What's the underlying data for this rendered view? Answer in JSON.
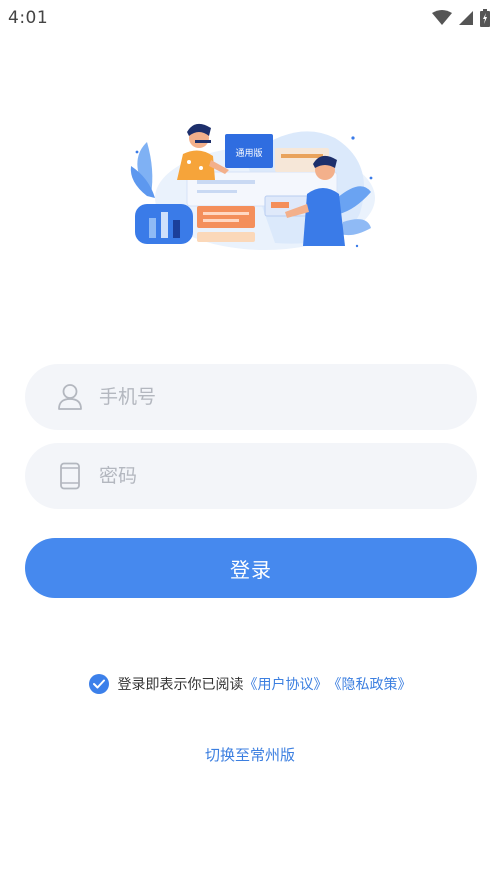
{
  "status_bar": {
    "time": "4:01",
    "icons": [
      "wifi-icon",
      "signal-icon",
      "battery-charging-icon"
    ]
  },
  "hero": {
    "screen_label": "通用版"
  },
  "login_form": {
    "phone_placeholder": "手机号",
    "phone_value": "",
    "password_placeholder": "密码",
    "password_value": "",
    "login_label": "登录"
  },
  "agreement": {
    "checked": true,
    "prefix": "登录即表示你已阅读",
    "user_agreement": "《用户协议》",
    "privacy_policy": "《隐私政策》"
  },
  "switch_version": {
    "label": "切换至常州版"
  },
  "colors": {
    "primary": "#4689ee",
    "link": "#3c7fe0",
    "field_bg": "#f3f5f9",
    "placeholder": "#b3b7bf"
  }
}
